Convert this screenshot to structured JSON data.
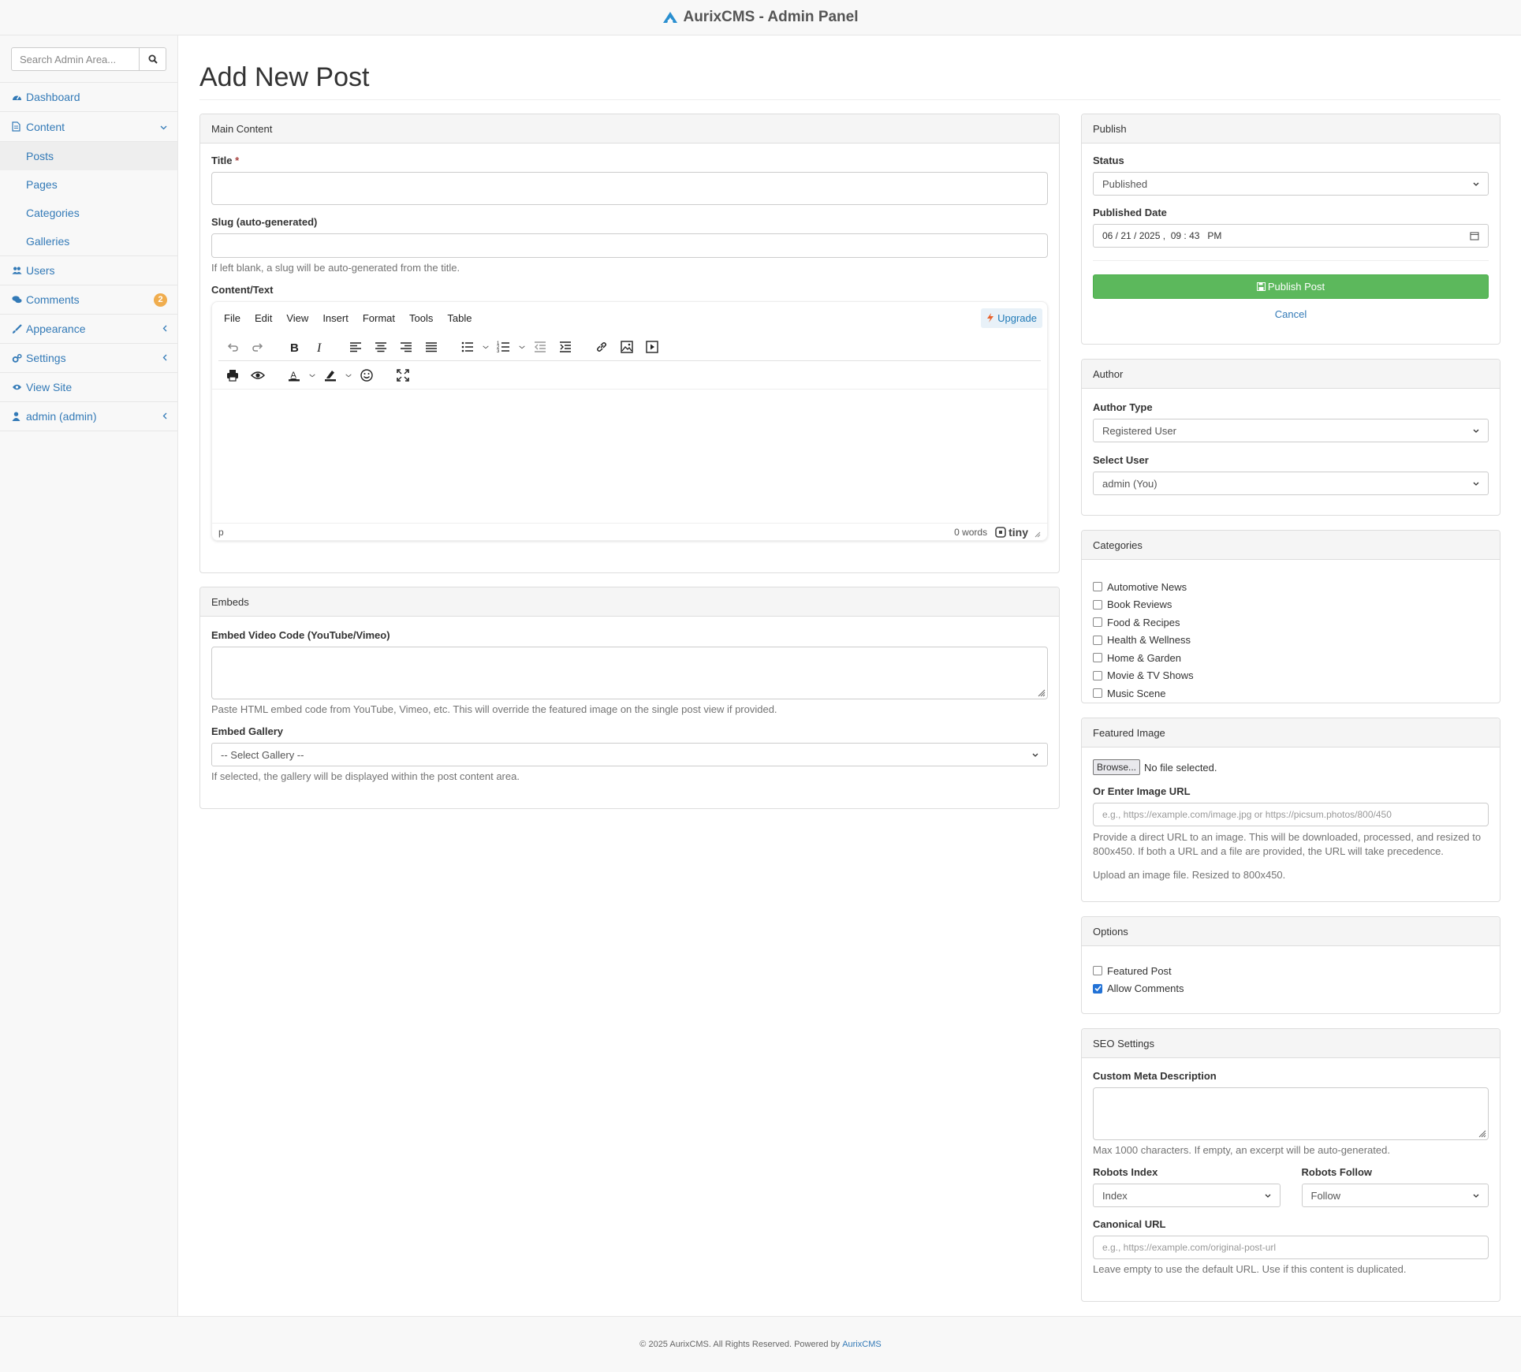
{
  "app": {
    "title": "AurixCMS - Admin Panel"
  },
  "sidebar": {
    "search_placeholder": "Search Admin Area...",
    "items": [
      {
        "label": "Dashboard",
        "icon": "dashboard-icon"
      },
      {
        "label": "Content",
        "icon": "file-icon",
        "expanded": true,
        "children": [
          "Posts",
          "Pages",
          "Categories",
          "Galleries"
        ],
        "active_child": "Posts"
      },
      {
        "label": "Users",
        "icon": "users-icon"
      },
      {
        "label": "Comments",
        "icon": "comments-icon",
        "badge": "2"
      },
      {
        "label": "Appearance",
        "icon": "brush-icon"
      },
      {
        "label": "Settings",
        "icon": "gears-icon"
      },
      {
        "label": "View Site",
        "icon": "eye-icon"
      },
      {
        "label": "admin (admin)",
        "icon": "user-icon"
      }
    ]
  },
  "page": {
    "title": "Add New Post"
  },
  "main_content": {
    "heading": "Main Content",
    "title_label": "Title",
    "title_required_mark": "*",
    "title_value": "",
    "slug_label": "Slug (auto-generated)",
    "slug_value": "",
    "slug_help": "If left blank, a slug will be auto-generated from the title.",
    "content_label": "Content/Text",
    "editor": {
      "menu": [
        "File",
        "Edit",
        "View",
        "Insert",
        "Format",
        "Tools",
        "Table"
      ],
      "upgrade_label": "Upgrade",
      "status_path": "p",
      "word_count": "0 words",
      "brand": "tiny"
    }
  },
  "embeds": {
    "heading": "Embeds",
    "video_label": "Embed Video Code (YouTube/Vimeo)",
    "video_help": "Paste HTML embed code from YouTube, Vimeo, etc. This will override the featured image on the single post view if provided.",
    "gallery_label": "Embed Gallery",
    "gallery_selected": "-- Select Gallery --",
    "gallery_help": "If selected, the gallery will be displayed within the post content area."
  },
  "publish": {
    "heading": "Publish",
    "status_label": "Status",
    "status_value": "Published",
    "date_label": "Published Date",
    "date_value": "06 / 21 / 2025 ,  09 : 43   PM",
    "publish_button": "Publish Post",
    "cancel_label": "Cancel"
  },
  "author": {
    "heading": "Author",
    "type_label": "Author Type",
    "type_value": "Registered User",
    "user_label": "Select User",
    "user_value": "admin (You)"
  },
  "categories": {
    "heading": "Categories",
    "items": [
      "Automotive News",
      "Book Reviews",
      "Food & Recipes",
      "Health & Wellness",
      "Home & Garden",
      "Movie & TV Shows",
      "Music Scene"
    ]
  },
  "featured_image": {
    "heading": "Featured Image",
    "browse_label": "Browse...",
    "no_file": "No file selected.",
    "url_label": "Or Enter Image URL",
    "url_placeholder": "e.g., https://example.com/image.jpg or https://picsum.photos/800/450",
    "url_help": "Provide a direct URL to an image. This will be downloaded, processed, and resized to 800x450. If both a URL and a file are provided, the URL will take precedence.",
    "upload_help": "Upload an image file. Resized to 800x450."
  },
  "options": {
    "heading": "Options",
    "featured_label": "Featured Post",
    "featured_checked": false,
    "comments_label": "Allow Comments",
    "comments_checked": true
  },
  "seo": {
    "heading": "SEO Settings",
    "meta_label": "Custom Meta Description",
    "meta_help": "Max 1000 characters. If empty, an excerpt will be auto-generated.",
    "robots_index_label": "Robots Index",
    "robots_index_value": "Index",
    "robots_follow_label": "Robots Follow",
    "robots_follow_value": "Follow",
    "canonical_label": "Canonical URL",
    "canonical_placeholder": "e.g., https://example.com/original-post-url",
    "canonical_help": "Leave empty to use the default URL. Use if this content is duplicated."
  },
  "footer": {
    "text": "© 2025 AurixCMS. All Rights Reserved. Powered by",
    "link": "AurixCMS"
  },
  "colors": {
    "link": "#337ab7",
    "publish_button": "#5cb85c",
    "badge": "#f0ad4e",
    "checkbox_on": "#2272d6"
  }
}
